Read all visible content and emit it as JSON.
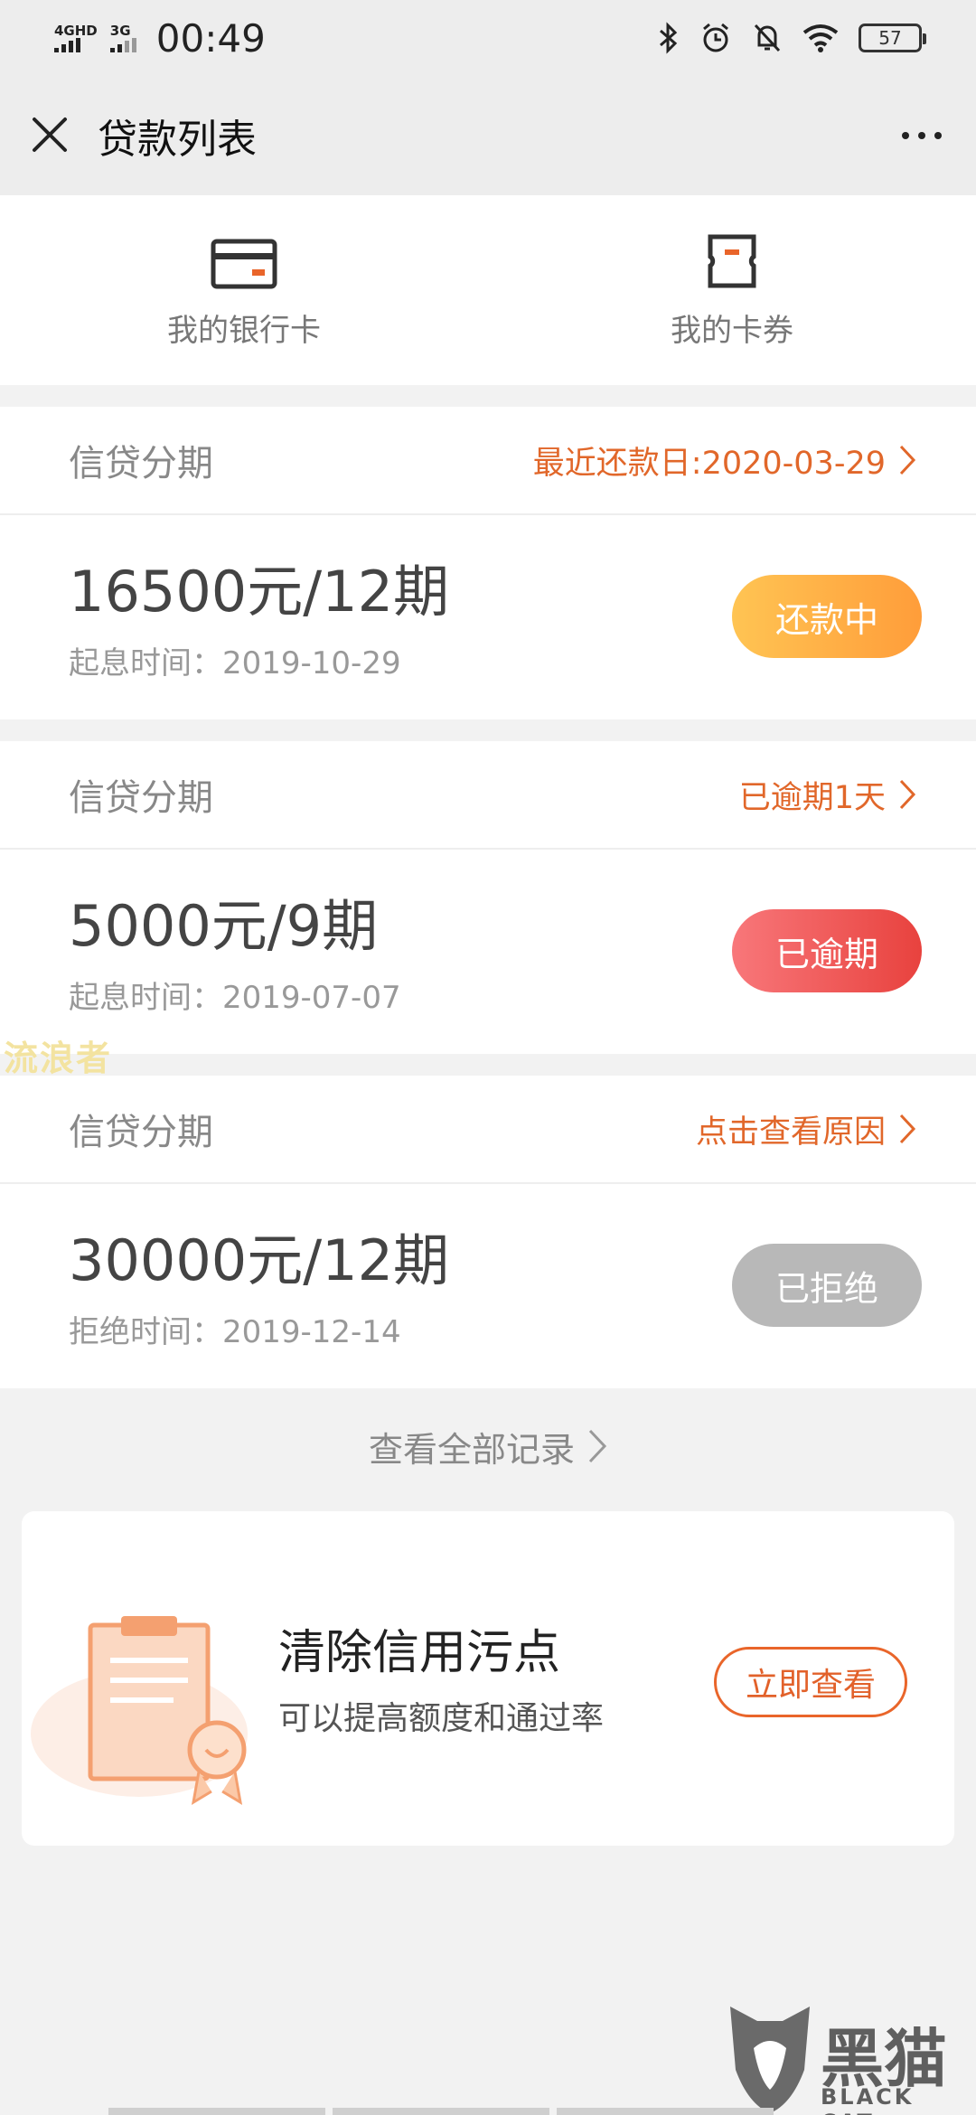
{
  "status_bar": {
    "network_1": "4GHD",
    "network_2": "3G",
    "time": "00:49",
    "battery": "57"
  },
  "title_bar": {
    "title": "贷款列表"
  },
  "quick_entries": [
    {
      "label": "我的银行卡",
      "icon": "bank-card-icon"
    },
    {
      "label": "我的卡券",
      "icon": "coupon-icon"
    }
  ],
  "loans": [
    {
      "type": "信贷分期",
      "link": "最近还款日:2020-03-29",
      "amount": "16500元/12期",
      "date": "起息时间：2019-10-29",
      "status": "还款中"
    },
    {
      "type": "信贷分期",
      "link": "已逾期1天",
      "amount": "5000元/9期",
      "date": "起息时间：2019-07-07",
      "status": "已逾期"
    },
    {
      "type": "信贷分期",
      "link": "点击查看原因",
      "amount": "30000元/12期",
      "date": "拒绝时间：2019-12-14",
      "status": "已拒绝"
    }
  ],
  "view_all": "查看全部记录",
  "promo": {
    "title": "清除信用污点",
    "subtitle": "可以提高额度和通过率",
    "button": "立即查看"
  },
  "watermark": "流浪者",
  "brand": {
    "cn": "黑猫",
    "en": "BLACK CAT"
  },
  "colors": {
    "accent": "#e1672a",
    "repaying": "#ffb347",
    "overdue": "#ee5a56",
    "rejected": "#b8b8b8"
  }
}
